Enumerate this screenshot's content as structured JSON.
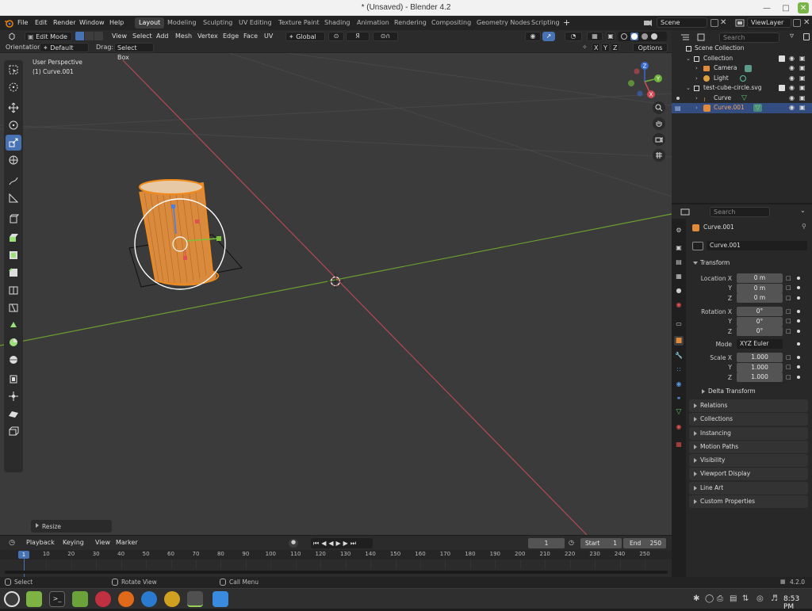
{
  "window": {
    "title": "* (Unsaved) - Blender 4.2"
  },
  "menu": [
    "File",
    "Edit",
    "Render",
    "Window",
    "Help"
  ],
  "workspaces": [
    "Layout",
    "Modeling",
    "Sculpting",
    "UV Editing",
    "Texture Paint",
    "Shading",
    "Animation",
    "Rendering",
    "Compositing",
    "Geometry Nodes",
    "Scripting"
  ],
  "scene": {
    "name": "Scene",
    "viewlayer": "ViewLayer"
  },
  "viewport_header": {
    "mode": "Edit Mode",
    "menus": [
      "View",
      "Select",
      "Add",
      "Mesh",
      "Vertex",
      "Edge",
      "Face",
      "UV"
    ],
    "transform_orientation": "Global",
    "orientation_label": "Orientation:",
    "orientation_value": "Default",
    "drag_label": "Drag:",
    "drag_value": "Select Box",
    "axes": [
      "X",
      "Y",
      "Z"
    ],
    "options": "Options"
  },
  "viewport": {
    "perspective": "User Perspective",
    "object": "(1) Curve.001",
    "last_op": "Resize",
    "gizmo_axes": [
      "X",
      "Y",
      "Z"
    ]
  },
  "outliner": {
    "search_placeholder": "Search",
    "rows": [
      {
        "label": "Scene Collection"
      },
      {
        "label": "Collection"
      },
      {
        "label": "Camera"
      },
      {
        "label": "Light"
      },
      {
        "label": "test-cube-circle.svg"
      },
      {
        "label": "Curve"
      },
      {
        "label": "Curve.001"
      }
    ]
  },
  "properties": {
    "search_placeholder": "Search",
    "object_name": "Curve.001",
    "datablock": "Curve.001",
    "transform_title": "Transform",
    "location": {
      "label": "Location X",
      "y": "Y",
      "z": "Z",
      "values": [
        "0 m",
        "0 m",
        "0 m"
      ]
    },
    "rotation": {
      "label": "Rotation X",
      "y": "Y",
      "z": "Z",
      "values": [
        "0°",
        "0°",
        "0°"
      ]
    },
    "mode_label": "Mode",
    "mode_value": "XYZ Euler",
    "scale": {
      "label": "Scale X",
      "y": "Y",
      "z": "Z",
      "values": [
        "1.000",
        "1.000",
        "1.000"
      ]
    },
    "delta": "Delta Transform",
    "sections": [
      "Relations",
      "Collections",
      "Instancing",
      "Motion Paths",
      "Visibility",
      "Viewport Display",
      "Line Art",
      "Custom Properties"
    ]
  },
  "timeline": {
    "menus": [
      "Playback",
      "Keying",
      "View",
      "Marker"
    ],
    "current_frame": "1",
    "start_label": "Start",
    "start": "1",
    "end_label": "End",
    "end": "250",
    "ticks": [
      "1",
      "10",
      "20",
      "30",
      "40",
      "50",
      "60",
      "70",
      "80",
      "90",
      "100",
      "110",
      "120",
      "130",
      "140",
      "150",
      "160",
      "170",
      "180",
      "190",
      "200",
      "210",
      "220",
      "230",
      "240",
      "250"
    ]
  },
  "status": {
    "select": "Select",
    "rotate": "Rotate View",
    "menu": "Call Menu",
    "version": "4.2.0"
  },
  "taskbar": {
    "time": "8:53 PM"
  }
}
